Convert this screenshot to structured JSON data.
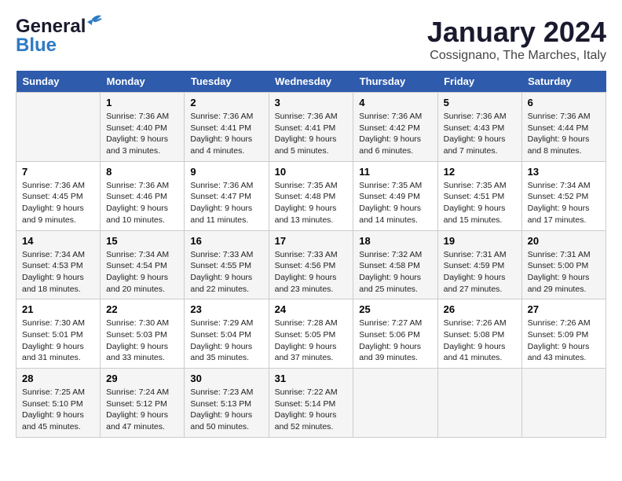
{
  "logo": {
    "line1": "General",
    "line2": "Blue"
  },
  "title": "January 2024",
  "subtitle": "Cossignano, The Marches, Italy",
  "headers": [
    "Sunday",
    "Monday",
    "Tuesday",
    "Wednesday",
    "Thursday",
    "Friday",
    "Saturday"
  ],
  "weeks": [
    [
      {
        "day": "",
        "info": ""
      },
      {
        "day": "1",
        "info": "Sunrise: 7:36 AM\nSunset: 4:40 PM\nDaylight: 9 hours\nand 3 minutes."
      },
      {
        "day": "2",
        "info": "Sunrise: 7:36 AM\nSunset: 4:41 PM\nDaylight: 9 hours\nand 4 minutes."
      },
      {
        "day": "3",
        "info": "Sunrise: 7:36 AM\nSunset: 4:41 PM\nDaylight: 9 hours\nand 5 minutes."
      },
      {
        "day": "4",
        "info": "Sunrise: 7:36 AM\nSunset: 4:42 PM\nDaylight: 9 hours\nand 6 minutes."
      },
      {
        "day": "5",
        "info": "Sunrise: 7:36 AM\nSunset: 4:43 PM\nDaylight: 9 hours\nand 7 minutes."
      },
      {
        "day": "6",
        "info": "Sunrise: 7:36 AM\nSunset: 4:44 PM\nDaylight: 9 hours\nand 8 minutes."
      }
    ],
    [
      {
        "day": "7",
        "info": "Sunrise: 7:36 AM\nSunset: 4:45 PM\nDaylight: 9 hours\nand 9 minutes."
      },
      {
        "day": "8",
        "info": "Sunrise: 7:36 AM\nSunset: 4:46 PM\nDaylight: 9 hours\nand 10 minutes."
      },
      {
        "day": "9",
        "info": "Sunrise: 7:36 AM\nSunset: 4:47 PM\nDaylight: 9 hours\nand 11 minutes."
      },
      {
        "day": "10",
        "info": "Sunrise: 7:35 AM\nSunset: 4:48 PM\nDaylight: 9 hours\nand 13 minutes."
      },
      {
        "day": "11",
        "info": "Sunrise: 7:35 AM\nSunset: 4:49 PM\nDaylight: 9 hours\nand 14 minutes."
      },
      {
        "day": "12",
        "info": "Sunrise: 7:35 AM\nSunset: 4:51 PM\nDaylight: 9 hours\nand 15 minutes."
      },
      {
        "day": "13",
        "info": "Sunrise: 7:34 AM\nSunset: 4:52 PM\nDaylight: 9 hours\nand 17 minutes."
      }
    ],
    [
      {
        "day": "14",
        "info": "Sunrise: 7:34 AM\nSunset: 4:53 PM\nDaylight: 9 hours\nand 18 minutes."
      },
      {
        "day": "15",
        "info": "Sunrise: 7:34 AM\nSunset: 4:54 PM\nDaylight: 9 hours\nand 20 minutes."
      },
      {
        "day": "16",
        "info": "Sunrise: 7:33 AM\nSunset: 4:55 PM\nDaylight: 9 hours\nand 22 minutes."
      },
      {
        "day": "17",
        "info": "Sunrise: 7:33 AM\nSunset: 4:56 PM\nDaylight: 9 hours\nand 23 minutes."
      },
      {
        "day": "18",
        "info": "Sunrise: 7:32 AM\nSunset: 4:58 PM\nDaylight: 9 hours\nand 25 minutes."
      },
      {
        "day": "19",
        "info": "Sunrise: 7:31 AM\nSunset: 4:59 PM\nDaylight: 9 hours\nand 27 minutes."
      },
      {
        "day": "20",
        "info": "Sunrise: 7:31 AM\nSunset: 5:00 PM\nDaylight: 9 hours\nand 29 minutes."
      }
    ],
    [
      {
        "day": "21",
        "info": "Sunrise: 7:30 AM\nSunset: 5:01 PM\nDaylight: 9 hours\nand 31 minutes."
      },
      {
        "day": "22",
        "info": "Sunrise: 7:30 AM\nSunset: 5:03 PM\nDaylight: 9 hours\nand 33 minutes."
      },
      {
        "day": "23",
        "info": "Sunrise: 7:29 AM\nSunset: 5:04 PM\nDaylight: 9 hours\nand 35 minutes."
      },
      {
        "day": "24",
        "info": "Sunrise: 7:28 AM\nSunset: 5:05 PM\nDaylight: 9 hours\nand 37 minutes."
      },
      {
        "day": "25",
        "info": "Sunrise: 7:27 AM\nSunset: 5:06 PM\nDaylight: 9 hours\nand 39 minutes."
      },
      {
        "day": "26",
        "info": "Sunrise: 7:26 AM\nSunset: 5:08 PM\nDaylight: 9 hours\nand 41 minutes."
      },
      {
        "day": "27",
        "info": "Sunrise: 7:26 AM\nSunset: 5:09 PM\nDaylight: 9 hours\nand 43 minutes."
      }
    ],
    [
      {
        "day": "28",
        "info": "Sunrise: 7:25 AM\nSunset: 5:10 PM\nDaylight: 9 hours\nand 45 minutes."
      },
      {
        "day": "29",
        "info": "Sunrise: 7:24 AM\nSunset: 5:12 PM\nDaylight: 9 hours\nand 47 minutes."
      },
      {
        "day": "30",
        "info": "Sunrise: 7:23 AM\nSunset: 5:13 PM\nDaylight: 9 hours\nand 50 minutes."
      },
      {
        "day": "31",
        "info": "Sunrise: 7:22 AM\nSunset: 5:14 PM\nDaylight: 9 hours\nand 52 minutes."
      },
      {
        "day": "",
        "info": ""
      },
      {
        "day": "",
        "info": ""
      },
      {
        "day": "",
        "info": ""
      }
    ]
  ]
}
